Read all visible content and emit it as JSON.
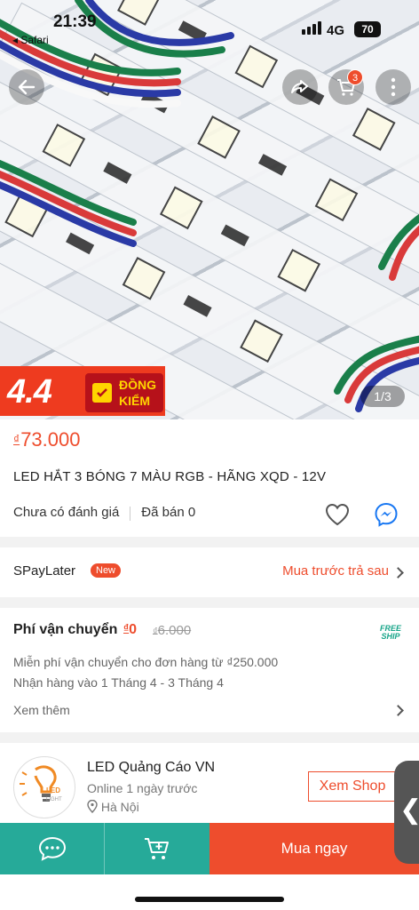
{
  "status_bar": {
    "time": "21:39",
    "back_app": "◂ Safari",
    "network": "4G",
    "battery": "70"
  },
  "hero": {
    "promo_number": "4.4",
    "promo_line1": "ĐỒNG",
    "promo_line2": "KIỂM",
    "pager": "1/3",
    "cart_count": "3",
    "icons": [
      "back-arrow-icon",
      "share-icon",
      "cart-icon",
      "more-icon"
    ]
  },
  "product": {
    "currency": "₫",
    "price": "73.000",
    "title": "LED HẮT 3 BÓNG 7 MÀU RGB - HÃNG XQD - 12V",
    "rating_text": "Chưa có đánh giá",
    "sold_text": "Đã bán 0"
  },
  "spaylater": {
    "label": "SPayLater",
    "tag": "New",
    "action": "Mua trước trả sau"
  },
  "shipping": {
    "label": "Phí vận chuyển",
    "price_currency": "₫",
    "price": "0",
    "old_currency": "₫",
    "old_price": "6.000",
    "freeship_line1": "FREE",
    "freeship_line2": "SHIP",
    "line1": "Miễn phí vận chuyển cho đơn hàng từ ₫250.000",
    "line2": "Nhận hàng vào 1 Tháng 4 - 3 Tháng 4",
    "more": "Xem thêm"
  },
  "shop": {
    "logo_text": "LED",
    "logo_sub": "LIGHT",
    "name": "LED Quảng Cáo VN",
    "online": "Online 1 ngày trước",
    "location": "Hà Nội",
    "button": "Xem Shop",
    "side_handle": "❮"
  },
  "bottom_bar": {
    "buy_now": "Mua ngay"
  },
  "colors": {
    "accent": "#ee4d2d",
    "teal": "#26aa99"
  }
}
